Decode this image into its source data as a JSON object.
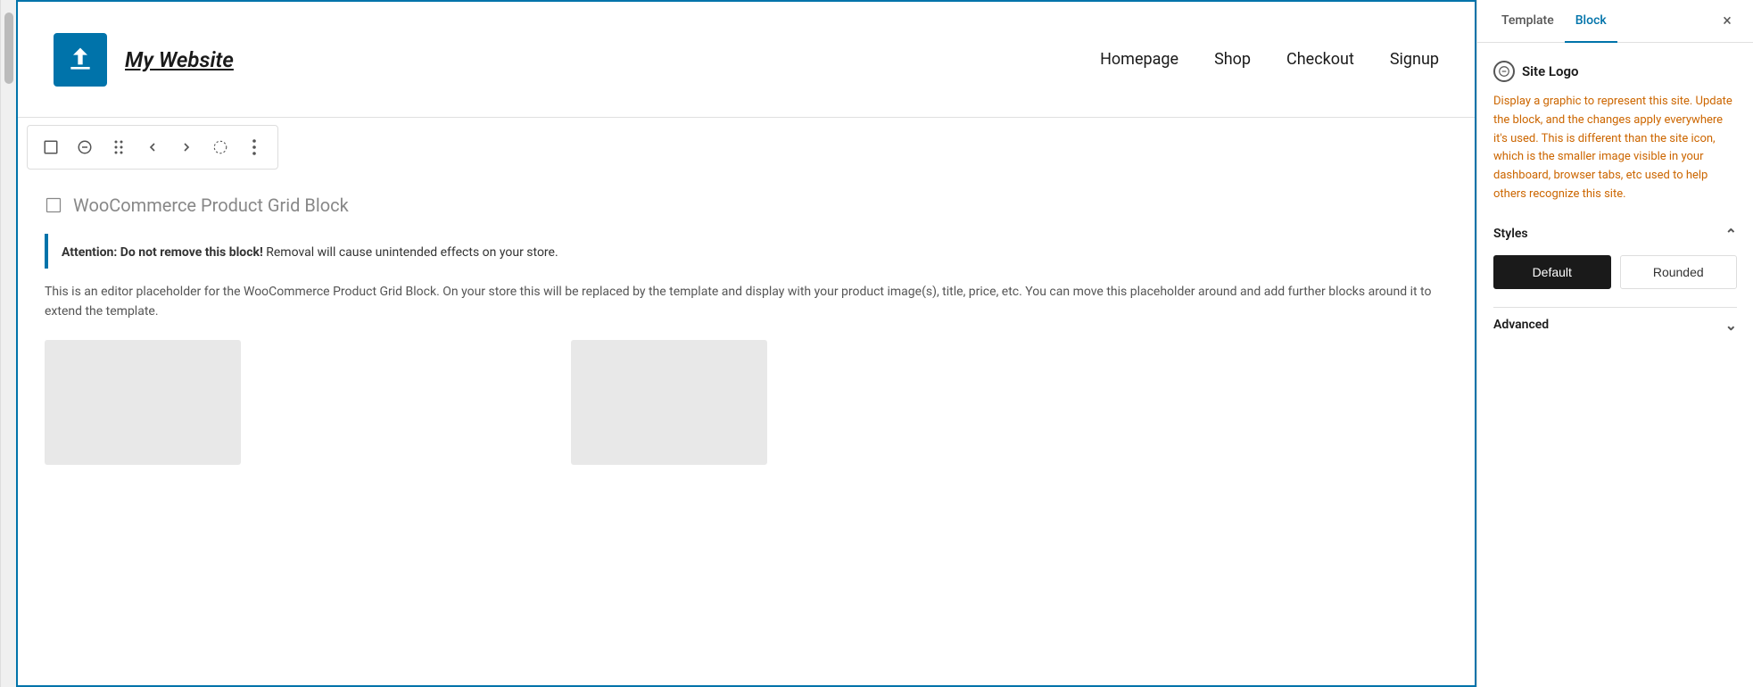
{
  "tabs": {
    "template": "Template",
    "block": "Block",
    "active": "block"
  },
  "header": {
    "site_title": "My Website",
    "nav_items": [
      "Homepage",
      "Shop",
      "Checkout",
      "Signup"
    ]
  },
  "toolbar": {
    "buttons": [
      {
        "name": "site-logo-block-btn",
        "icon": "⊡",
        "label": "Site Logo"
      },
      {
        "name": "minus-circle-btn",
        "icon": "⊖",
        "label": "Remove"
      },
      {
        "name": "drag-btn",
        "icon": "⠿",
        "label": "Drag"
      },
      {
        "name": "prev-btn",
        "icon": "‹",
        "label": "Previous"
      },
      {
        "name": "next-btn",
        "icon": "›",
        "label": "Next"
      },
      {
        "name": "circle-dotted-btn",
        "icon": "◌",
        "label": "Loading"
      },
      {
        "name": "more-options-btn",
        "icon": "⋮",
        "label": "More Options"
      }
    ]
  },
  "main_content": {
    "block_title": "WooCommerce Product Grid Block",
    "alert_text_bold": "Attention: Do not remove this block!",
    "alert_text_normal": " Removal will cause unintended effects on your store.",
    "description": "This is an editor placeholder for the WooCommerce Product Grid Block. On your store this will be replaced by the template and display with your product image(s), title, price, etc. You can move this placeholder around and add further blocks around it to extend the template."
  },
  "right_panel": {
    "close_label": "×",
    "site_logo_label": "Site Logo",
    "site_logo_description": "Display a graphic to represent this site. Update the block, and the changes apply everywhere it's used. This is different than the site icon, which is the smaller image visible in your dashboard, browser tabs, etc used to help others recognize this site.",
    "styles_label": "Styles",
    "style_default_label": "Default",
    "style_rounded_label": "Rounded",
    "active_style": "default",
    "advanced_label": "Advanced"
  }
}
